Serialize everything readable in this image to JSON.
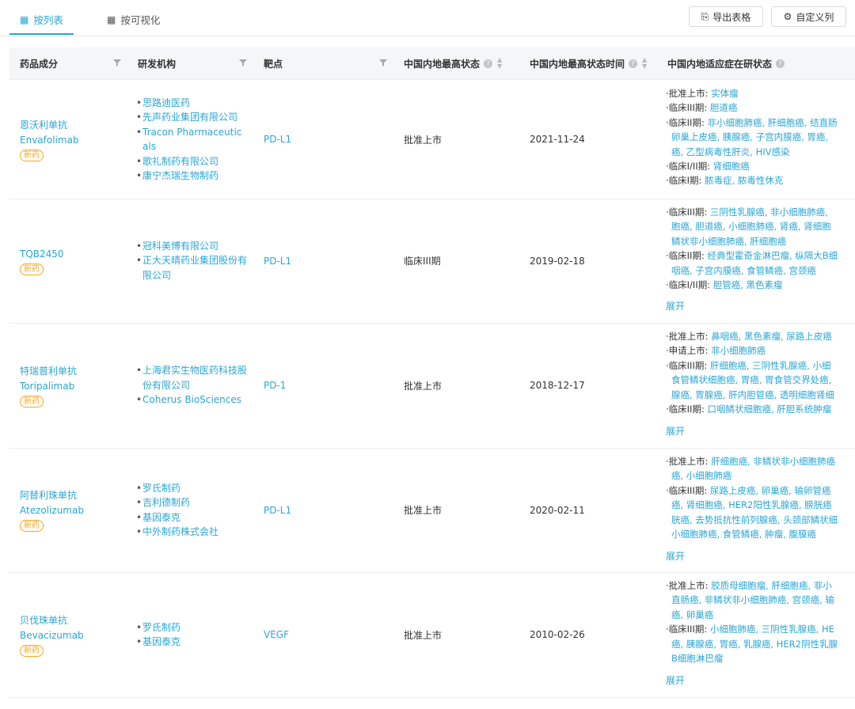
{
  "tabs": [
    {
      "label": "按列表",
      "icon": "table-icon",
      "active": true
    },
    {
      "label": "按可视化",
      "icon": "grid-icon",
      "active": false
    }
  ],
  "toolbar": {
    "export_label": "导出表格",
    "custom_label": "自定义列"
  },
  "columns": {
    "drug": "药品成分",
    "org": "研发机构",
    "target": "靶点",
    "status": "中国内地最高状态",
    "date": "中国内地最高状态时间",
    "indication": "中国内地适应症在研状态"
  },
  "expand_label": "展开",
  "badge_label": "新药",
  "rows": [
    {
      "drug_cn": "恩沃利单抗",
      "drug_en": "Envafolimab",
      "orgs": [
        "思路迪医药",
        "先声药业集团有限公司",
        "Tracon Pharmaceuticals",
        "歌礼制药有限公司",
        "康宁杰瑞生物制药"
      ],
      "target": "PD-L1",
      "status": "批准上市",
      "date": "2021-11-24",
      "indications": [
        [
          "·批准上市: ",
          "实体瘤"
        ],
        [
          "·临床III期: ",
          "胆道癌"
        ],
        [
          "·临床II期: ",
          "非小细胞肺癌, 肝细胞癌, 结直肠"
        ],
        [
          "",
          "卵巢上皮癌, 胰腺癌, 子宫内膜癌, 胃癌,"
        ],
        [
          "",
          "癌, 乙型病毒性肝炎, HIV感染"
        ],
        [
          "·临床I/II期: ",
          "肾细胞癌"
        ],
        [
          "·临床I期: ",
          "脓毒症, 脓毒性休克"
        ]
      ],
      "expand": false
    },
    {
      "drug_cn": "TQB2450",
      "drug_en": "",
      "orgs": [
        "冠科美博有限公司",
        "正大天晴药业集团股份有限公司"
      ],
      "target": "PD-L1",
      "status": "临床III期",
      "date": "2019-02-18",
      "indications": [
        [
          "·临床III期: ",
          "三阴性乳腺癌, 非小细胞肺癌,"
        ],
        [
          "",
          "胞癌, 胆道癌, 小细胞肺癌, 肾癌, 肾细胞"
        ],
        [
          "",
          "鳞状非小细胞肺癌, 肝细胞癌"
        ],
        [
          "·临床II期: ",
          "经典型霍奇金淋巴瘤, 纵隔大B细"
        ],
        [
          "",
          "咽癌, 子宫内膜癌, 食管鳞癌, 宫颈癌"
        ],
        [
          "·临床I/II期: ",
          "胆管癌, 黑色素瘤"
        ]
      ],
      "expand": true
    },
    {
      "drug_cn": "特瑞普利单抗",
      "drug_en": "Toripalimab",
      "orgs": [
        "上海君实生物医药科技股份有限公司",
        "Coherus BioSciences"
      ],
      "target": "PD-1",
      "status": "批准上市",
      "date": "2018-12-17",
      "indications": [
        [
          "·批准上市: ",
          "鼻咽癌, 黑色素瘤, 尿路上皮癌"
        ],
        [
          "·申请上市: ",
          "非小细胞肺癌"
        ],
        [
          "·临床III期: ",
          "肝细胞癌, 三阴性乳腺癌, 小细"
        ],
        [
          "",
          "食管鳞状细胞癌, 胃癌, 胃食管交界处癌,"
        ],
        [
          "",
          "腺癌, 胃腺癌, 肝内胆管癌, 透明细胞肾细"
        ],
        [
          "·临床II期: ",
          "口咽鳞状细胞癌, 肝胆系统肿瘤"
        ]
      ],
      "expand": true
    },
    {
      "drug_cn": "阿替利珠单抗",
      "drug_en": "Atezolizumab",
      "orgs": [
        "罗氏制药",
        "吉利德制药",
        "基因泰克",
        "中外制药株式会社"
      ],
      "target": "PD-L1",
      "status": "批准上市",
      "date": "2020-02-11",
      "indications": [
        [
          "·批准上市: ",
          "肝细胞癌, 非鳞状非小细胞肺癌"
        ],
        [
          "",
          "癌, 小细胞肺癌"
        ],
        [
          "·临床III期: ",
          "尿路上皮癌, 卵巢癌, 输卵管癌"
        ],
        [
          "",
          "癌, 肾细胞癌, HER2阳性乳腺癌, 膀胱癌"
        ],
        [
          "",
          "胱癌, 去势抵抗性前列腺癌, 头颈部鳞状细"
        ],
        [
          "",
          "小细胞肺癌, 食管鳞癌, 肿瘤, 腹膜癌"
        ]
      ],
      "expand": true
    },
    {
      "drug_cn": "贝伐珠单抗",
      "drug_en": "Bevacizumab",
      "orgs": [
        "罗氏制药",
        "基因泰克"
      ],
      "target": "VEGF",
      "status": "批准上市",
      "date": "2010-02-26",
      "indications": [
        [
          "·批准上市: ",
          "胶质母细胞瘤, 肝细胞癌, 非小"
        ],
        [
          "",
          "直肠癌, 非鳞状非小细胞肺癌, 宫颈癌, 输"
        ],
        [
          "",
          "癌, 卵巢癌"
        ],
        [
          "·临床III期: ",
          "小细胞肺癌, 三阴性乳腺癌, HE"
        ],
        [
          "",
          "癌, 胰腺癌, 胃癌, 乳腺癌, HER2阴性乳腺"
        ],
        [
          "",
          "B细胞淋巴瘤"
        ]
      ],
      "expand": true
    }
  ]
}
